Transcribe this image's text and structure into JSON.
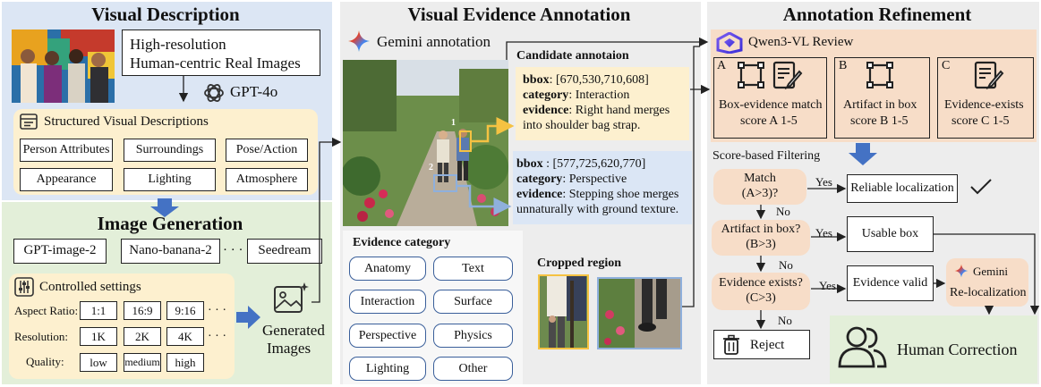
{
  "panels": {
    "visual_description": "Visual Description",
    "image_generation": "Image Generation",
    "visual_evidence": "Visual Evidence Annotation",
    "refinement": "Annotation Refinement"
  },
  "vd": {
    "real_images_line1": "High-resolution",
    "real_images_line2": "Human-centric Real Images",
    "model": "GPT-4o",
    "structured_title": "Structured Visual Descriptions",
    "attributes": [
      "Person Attributes",
      "Surroundings",
      "Pose/Action",
      "Appearance",
      "Lighting",
      "Atmosphere"
    ]
  },
  "ig": {
    "models": [
      "GPT-image-2",
      "Nano-banana-2",
      "· · ·",
      "Seedream"
    ],
    "controlled_title": "Controlled settings",
    "aspect_label": "Aspect Ratio:",
    "aspect_values": [
      "1:1",
      "16:9",
      "9:16"
    ],
    "resolution_label": "Resolution:",
    "resolution_values": [
      "1K",
      "2K",
      "4K"
    ],
    "quality_label": "Quality:",
    "quality_values": [
      "low",
      "medium",
      "high"
    ],
    "more": "· · ·",
    "generated_line1": "Generated",
    "generated_line2": "Images"
  },
  "ve": {
    "gemini": "Gemini annotation",
    "candidate_title": "Candidate annotaion",
    "ann1": {
      "bbox_key": "bbox",
      "bbox_val": ": [670,530,710,608]",
      "cat_key": "category",
      "cat_val": ": Interaction",
      "ev_key": "evidence",
      "ev_val_line1": ": Right hand merges",
      "ev_val_line2": "into shoulder bag strap."
    },
    "ann2": {
      "bbox_key": "bbox",
      "bbox_val": " : [577,725,620,770]",
      "cat_key": "category",
      "cat_val": ": Perspective",
      "ev_key": "evidence",
      "ev_val_line1": ": Stepping shoe merges",
      "ev_val_line2": "unnaturally with ground texture."
    },
    "marker1": "1",
    "marker2": "2",
    "evidence_category_title": "Evidence category",
    "categories": [
      "Anatomy",
      "Text",
      "Interaction",
      "Surface",
      "Perspective",
      "Physics",
      "Lighting",
      "Other"
    ],
    "cropped_title": "Cropped region"
  },
  "ar": {
    "qwen": "Qwen3-VL Review",
    "score_a_letter": "A",
    "score_a_line1": "Box-evidence match",
    "score_a_line2": "score A 1-5",
    "score_b_letter": "B",
    "score_b_line1": "Artifact in box",
    "score_b_line2": "score B 1-5",
    "score_c_letter": "C",
    "score_c_line1": "Evidence-exists",
    "score_c_line2": "score C 1-5",
    "filter_title": "Score-based Filtering",
    "d1_line1": "Match",
    "d1_line2": "(A>3)?",
    "d2_line1": "Artifact in box?",
    "d2_line2": "(B>3)",
    "d3_line1": "Evidence exists?",
    "d3_line2": "(C>3)",
    "yes": "Yes",
    "no": "No",
    "r1": "Reliable localization",
    "r2": "Usable box",
    "r3": "Evidence valid",
    "gemini": "Gemini",
    "reloc": "Re-localization",
    "reject": "Reject",
    "human": "Human Correction"
  },
  "colors": {
    "vd_bg": "#dce6f4",
    "ig_bg": "#e3efd9",
    "ve_bg": "#ededed",
    "ar_bg": "#ededed",
    "cream": "#fdf0cf",
    "peach": "#f7ddc8",
    "arrow_blue": "#4472c4",
    "yellow": "#f5c242",
    "light_blue": "#8fb0dc"
  }
}
